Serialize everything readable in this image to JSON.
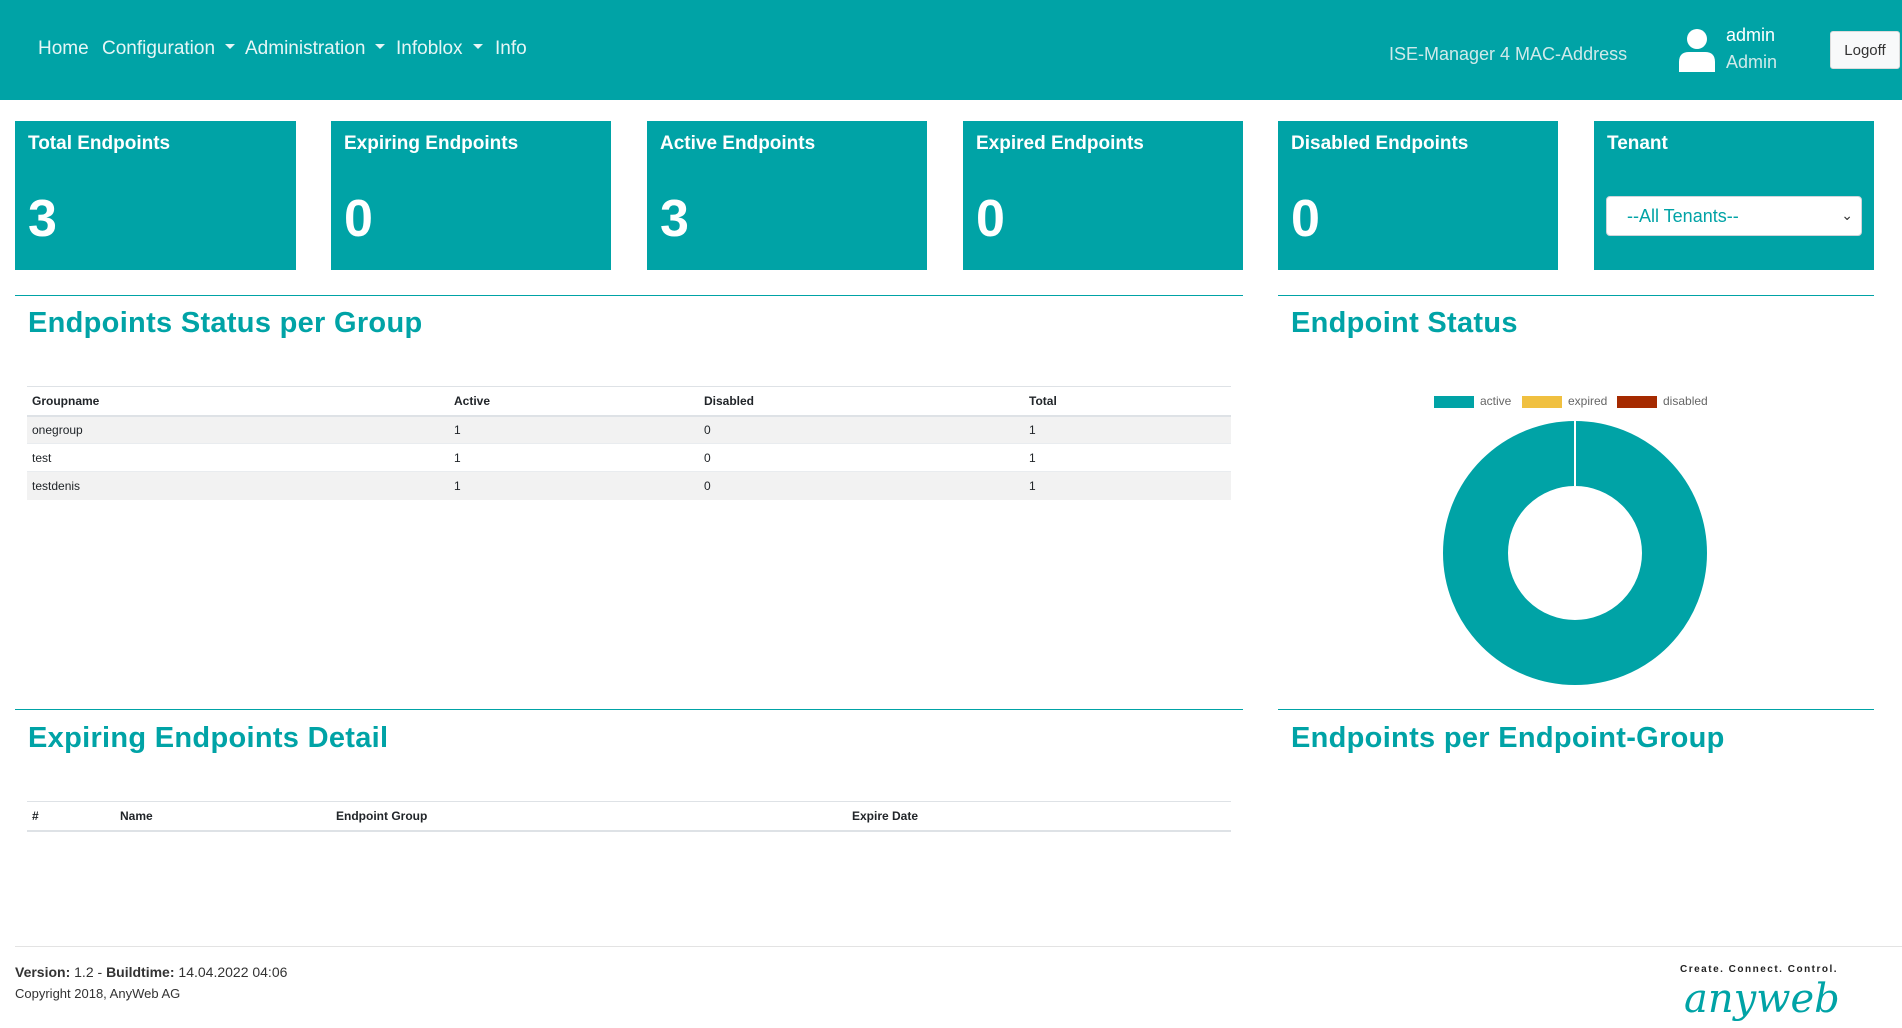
{
  "nav": {
    "items": [
      {
        "label": "Home",
        "dropdown": false
      },
      {
        "label": "Configuration",
        "dropdown": true
      },
      {
        "label": "Administration",
        "dropdown": true
      },
      {
        "label": "Infoblox",
        "dropdown": true
      },
      {
        "label": "Info",
        "dropdown": false
      }
    ],
    "app_title": "ISE-Manager 4 MAC-Address",
    "user_name": "admin",
    "user_role": "Admin",
    "logoff_label": "Logoff"
  },
  "cards": [
    {
      "title": "Total Endpoints",
      "value": "3"
    },
    {
      "title": "Expiring Endpoints",
      "value": "0"
    },
    {
      "title": "Active Endpoints",
      "value": "3"
    },
    {
      "title": "Expired Endpoints",
      "value": "0"
    },
    {
      "title": "Disabled Endpoints",
      "value": "0"
    }
  ],
  "tenant": {
    "title": "Tenant",
    "selected": "--All Tenants--"
  },
  "status_per_group": {
    "title": "Endpoints Status per Group",
    "columns": [
      "Groupname",
      "Active",
      "Disabled",
      "Total"
    ],
    "rows": [
      [
        "onegroup",
        "1",
        "0",
        "1"
      ],
      [
        "test",
        "1",
        "0",
        "1"
      ],
      [
        "testdenis",
        "1",
        "0",
        "1"
      ]
    ]
  },
  "endpoint_status": {
    "title": "Endpoint Status"
  },
  "chart_data": {
    "type": "pie",
    "donut": true,
    "categories": [
      "active",
      "expired",
      "disabled"
    ],
    "values": [
      3,
      0,
      0
    ],
    "colors": [
      "#00a3a6",
      "#f0c040",
      "#a52a00"
    ],
    "legend": "top"
  },
  "expiring_detail": {
    "title": "Expiring Endpoints Detail",
    "columns": [
      "#",
      "Name",
      "Endpoint Group",
      "Expire Date"
    ],
    "rows": []
  },
  "per_group": {
    "title": "Endpoints per Endpoint-Group"
  },
  "footer": {
    "version_label": "Version:",
    "version": "1.2",
    "sep": "-",
    "buildtime_label": "Buildtime:",
    "buildtime": "14.04.2022 04:06",
    "copyright": "Copyright 2018, AnyWeb AG",
    "brand_tagline": "Create. Connect. Control.",
    "brand_name": "anyweb"
  },
  "colors": {
    "accent": "#00a3a6"
  }
}
